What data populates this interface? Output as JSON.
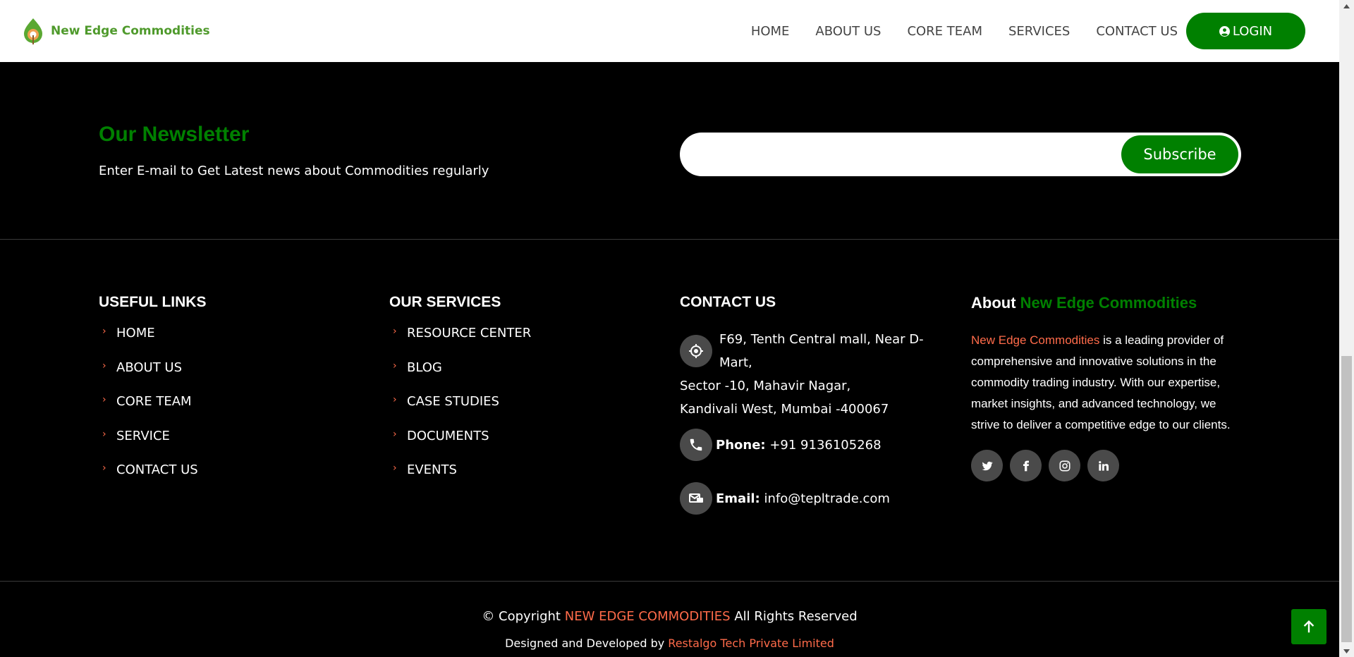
{
  "header": {
    "brand_name": "New Edge Commodities",
    "nav": [
      "HOME",
      "ABOUT US",
      "CORE TEAM",
      "SERVICES",
      "CONTACT US"
    ],
    "login_label": "LOGIN"
  },
  "newsletter": {
    "title": "Our Newsletter",
    "description": "Enter E-mail to Get Latest news about Commodities regularly",
    "input_placeholder": "",
    "subscribe_label": "Subscribe"
  },
  "useful_links": {
    "title": "USEFUL LINKS",
    "items": [
      "HOME",
      "ABOUT US",
      "CORE TEAM",
      "SERVICE",
      "CONTACT US"
    ]
  },
  "our_services": {
    "title": "OUR SERVICES",
    "items": [
      "RESOURCE CENTER",
      "BLOG",
      "CASE STUDIES",
      "DOCUMENTS",
      "EVENTS"
    ]
  },
  "contact": {
    "title": "CONTACT US",
    "address_line1": "F69, Tenth Central mall, Near D-Mart,",
    "address_line2": "Sector -10, Mahavir Nagar,",
    "address_line3": "Kandivali West, Mumbai -400067",
    "phone_label": "Phone:",
    "phone": "+91 9136105268",
    "email_label": "Email:",
    "email": "info@tepltrade.com"
  },
  "about": {
    "title_prefix": "About",
    "title_brand": "New Edge Commodities",
    "brand": "New Edge Commodities",
    "text": " is a leading provider of comprehensive and innovative solutions in the commodity trading industry. With our expertise, market insights, and advanced technology, we strive to deliver a competitive edge to our clients.",
    "social": [
      "twitter-icon",
      "facebook-icon",
      "instagram-icon",
      "linkedin-icon"
    ]
  },
  "footer": {
    "copyright_prefix": "© Copyright",
    "copyright_brand": "NEW EDGE COMMODITIES",
    "copyright_suffix": "All Rights Reserved",
    "designed_prefix": "Designed and Developed by",
    "designed_company": "Restalgo Tech Private Limited"
  },
  "colors": {
    "brand_green": "#008000",
    "accent_orange": "#ff6b4a",
    "background": "#000000"
  }
}
